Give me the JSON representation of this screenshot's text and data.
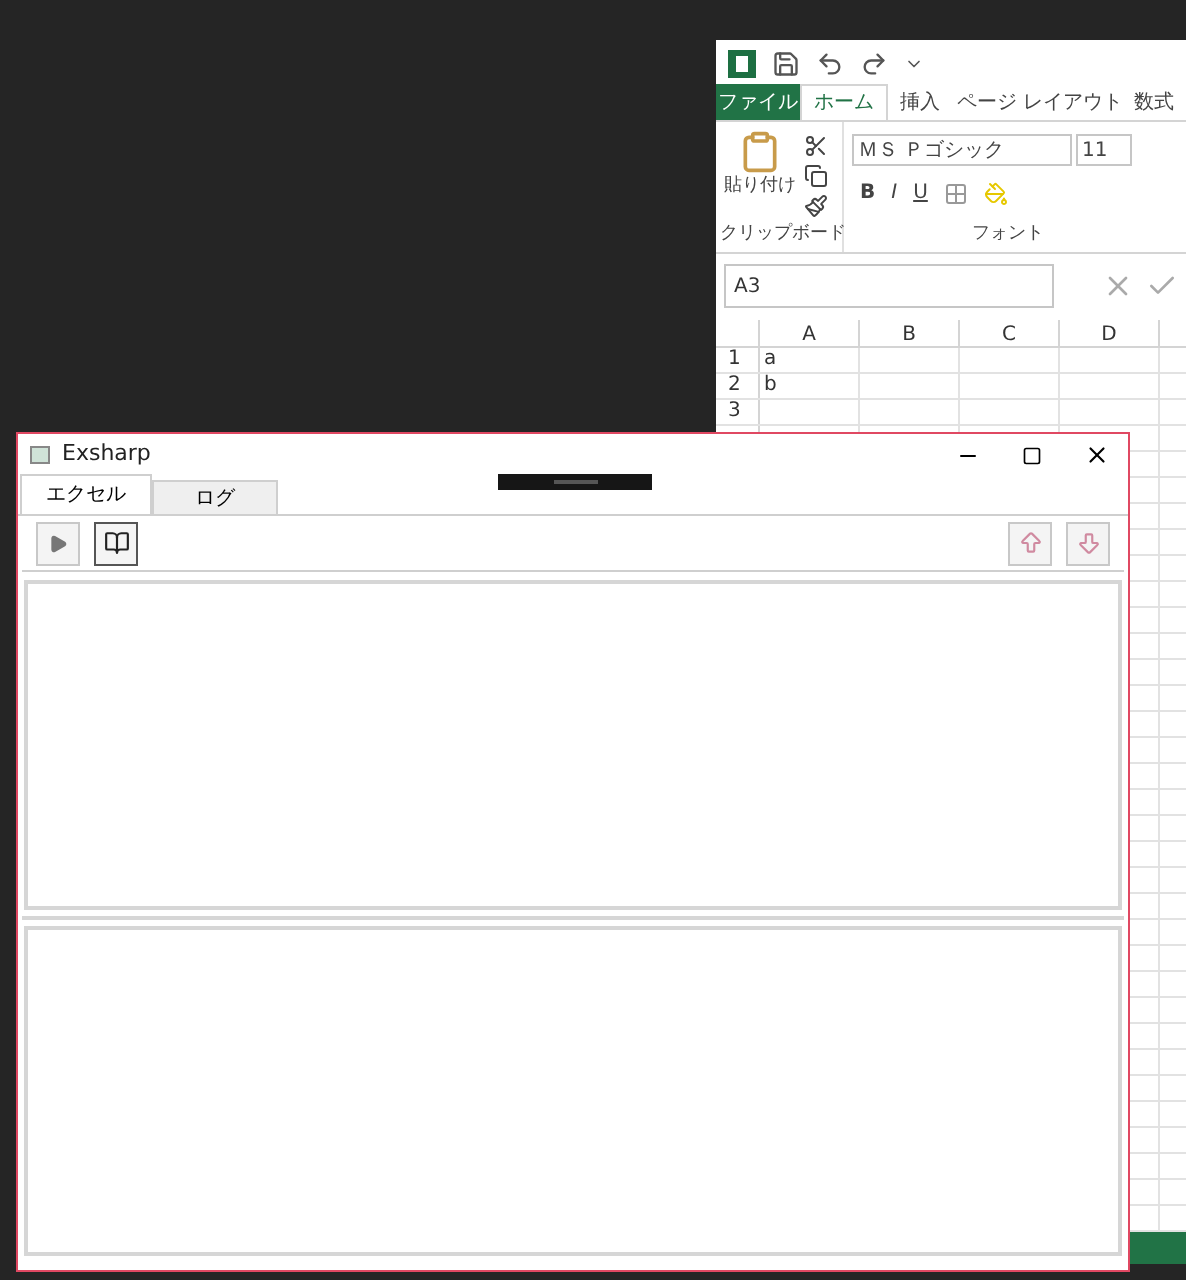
{
  "excel": {
    "tabs": [
      {
        "label": "ファイル",
        "kind": "file",
        "selected": false
      },
      {
        "label": "ホーム",
        "kind": "tab",
        "selected": true
      },
      {
        "label": "挿入",
        "kind": "tab",
        "selected": false
      },
      {
        "label": "ページ レイアウト",
        "kind": "tab",
        "selected": false
      },
      {
        "label": "数式",
        "kind": "tab",
        "selected": false
      }
    ],
    "paste_label": "貼り付け",
    "clipboard_group": "クリップボード",
    "font_group": "フォント",
    "font_name": "ＭＳ Ｐゴシック",
    "font_size": "11",
    "format_buttons": [
      "B",
      "I",
      "U"
    ],
    "name_box": "A3",
    "columns": [
      "A",
      "B",
      "C",
      "D"
    ],
    "rows": [
      {
        "header": "1",
        "cells": [
          "a",
          "",
          "",
          ""
        ]
      },
      {
        "header": "2",
        "cells": [
          "b",
          "",
          "",
          ""
        ]
      },
      {
        "header": "3",
        "cells": [
          "",
          "",
          "",
          ""
        ]
      }
    ]
  },
  "app": {
    "title": "Exsharp",
    "tabs": [
      {
        "label": "エクセル",
        "selected": true
      },
      {
        "label": "ログ",
        "selected": false
      }
    ],
    "toolbar": [
      {
        "kind": "play"
      },
      {
        "kind": "book"
      }
    ],
    "toolbar_right": [
      {
        "kind": "up"
      },
      {
        "kind": "down"
      }
    ]
  }
}
